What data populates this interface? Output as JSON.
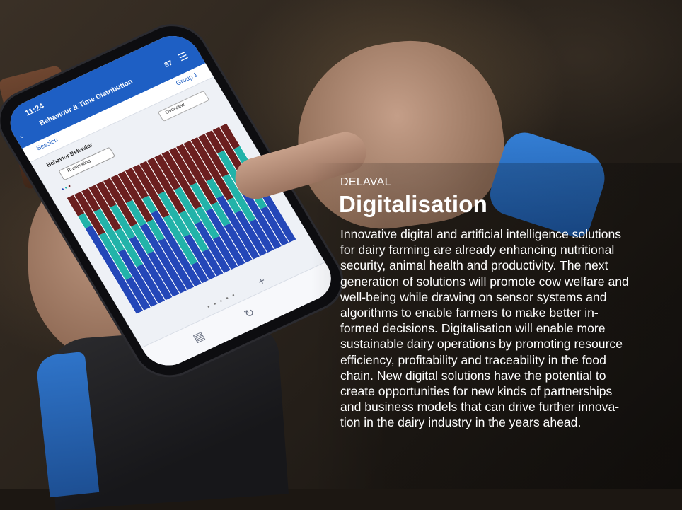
{
  "article": {
    "kicker": "DELAVAL",
    "headline": "Digitalisation",
    "body_lines": [
      "Innovative digital and artificial intelligence solutions",
      "for dairy farming are already enhancing nutritional",
      "security, animal health and productivity. The next",
      "generation of solutions will promote cow welfare and",
      "well-being while drawing on sensor systems and",
      "algorithms to enable farmers to make better in-",
      "formed decisions. Digitalisation will enable more",
      "sustainable dairy operations by promoting resource",
      "efficiency, profitability and traceability in the food",
      "chain. New digital solutions have the potential to",
      "create opportunities for new kinds of partnerships",
      "and business models that can drive further innova-",
      "tion in the dairy industry in the years ahead."
    ]
  },
  "phone_screen": {
    "time": "11:24",
    "title": "Behaviour & Time Distribution",
    "count": "87",
    "tab_left": "Session",
    "tab_right": "Group 1",
    "section_label": "Behavior Behavior",
    "pill_label": "Ruminating",
    "dropdown_label": "Overview",
    "icons": [
      "back-chevron-icon",
      "menu-icon",
      "add-icon",
      "chart-icon",
      "refresh-icon"
    ],
    "bar_colors": {
      "dark_red": "#6b1f1f",
      "teal": "#22b3a9",
      "blue": "#2447b8"
    }
  },
  "colors": {
    "text": "#ffffff",
    "sleeve_blue": "#2f74c9"
  }
}
